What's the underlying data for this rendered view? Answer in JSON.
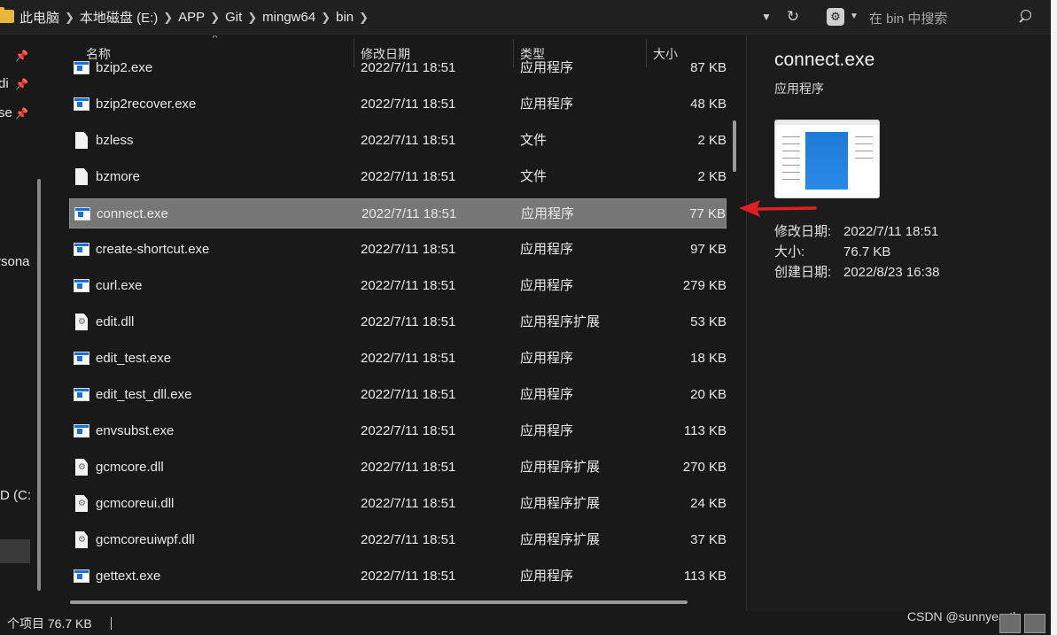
{
  "address": {
    "crumbs": [
      "此电脑",
      "本地磁盘 (E:)",
      "APP",
      "Git",
      "mingw64",
      "bin"
    ],
    "chevron_icon": "chevron-down-icon",
    "refresh_icon": "refresh-icon"
  },
  "search": {
    "placeholder": "在 bin 中搜索",
    "icon": "search-icon"
  },
  "nav": {
    "items": [
      {
        "label": "di",
        "pinned": true
      },
      {
        "label": "se",
        "pinned": true
      },
      {
        "label": "rsona",
        "pinned": false
      },
      {
        "label": "D (C:",
        "pinned": false
      }
    ]
  },
  "columns": {
    "name": "名称",
    "date": "修改日期",
    "type": "类型",
    "size": "大小"
  },
  "files": [
    {
      "name": "bzip2.exe",
      "date": "2022/7/11 18:51",
      "type": "应用程序",
      "size": "87 KB",
      "icon": "exe",
      "selected": false
    },
    {
      "name": "bzip2recover.exe",
      "date": "2022/7/11 18:51",
      "type": "应用程序",
      "size": "48 KB",
      "icon": "exe",
      "selected": false
    },
    {
      "name": "bzless",
      "date": "2022/7/11 18:51",
      "type": "文件",
      "size": "2 KB",
      "icon": "file",
      "selected": false
    },
    {
      "name": "bzmore",
      "date": "2022/7/11 18:51",
      "type": "文件",
      "size": "2 KB",
      "icon": "file",
      "selected": false
    },
    {
      "name": "connect.exe",
      "date": "2022/7/11 18:51",
      "type": "应用程序",
      "size": "77 KB",
      "icon": "exe",
      "selected": true
    },
    {
      "name": "create-shortcut.exe",
      "date": "2022/7/11 18:51",
      "type": "应用程序",
      "size": "97 KB",
      "icon": "exe",
      "selected": false
    },
    {
      "name": "curl.exe",
      "date": "2022/7/11 18:51",
      "type": "应用程序",
      "size": "279 KB",
      "icon": "exe",
      "selected": false
    },
    {
      "name": "edit.dll",
      "date": "2022/7/11 18:51",
      "type": "应用程序扩展",
      "size": "53 KB",
      "icon": "dll",
      "selected": false
    },
    {
      "name": "edit_test.exe",
      "date": "2022/7/11 18:51",
      "type": "应用程序",
      "size": "18 KB",
      "icon": "exe",
      "selected": false
    },
    {
      "name": "edit_test_dll.exe",
      "date": "2022/7/11 18:51",
      "type": "应用程序",
      "size": "20 KB",
      "icon": "exe",
      "selected": false
    },
    {
      "name": "envsubst.exe",
      "date": "2022/7/11 18:51",
      "type": "应用程序",
      "size": "113 KB",
      "icon": "exe",
      "selected": false
    },
    {
      "name": "gcmcore.dll",
      "date": "2022/7/11 18:51",
      "type": "应用程序扩展",
      "size": "270 KB",
      "icon": "dll",
      "selected": false
    },
    {
      "name": "gcmcoreui.dll",
      "date": "2022/7/11 18:51",
      "type": "应用程序扩展",
      "size": "24 KB",
      "icon": "dll",
      "selected": false
    },
    {
      "name": "gcmcoreuiwpf.dll",
      "date": "2022/7/11 18:51",
      "type": "应用程序扩展",
      "size": "37 KB",
      "icon": "dll",
      "selected": false
    },
    {
      "name": "gettext.exe",
      "date": "2022/7/11 18:51",
      "type": "应用程序",
      "size": "113 KB",
      "icon": "exe",
      "selected": false
    }
  ],
  "preview": {
    "title": "connect.exe",
    "type": "应用程序",
    "props": [
      {
        "key": "修改日期:",
        "value": "2022/7/11 18:51"
      },
      {
        "key": "大小:",
        "value": "76.7 KB"
      },
      {
        "key": "创建日期:",
        "value": "2022/8/23 16:38"
      }
    ]
  },
  "status": {
    "text": "个项目  76.7 KB"
  },
  "watermark": "CSDN @sunnyearth",
  "colors": {
    "selected_row": "#777777",
    "arrow": "#e02020",
    "exe_blue": "#1b6fd1"
  }
}
